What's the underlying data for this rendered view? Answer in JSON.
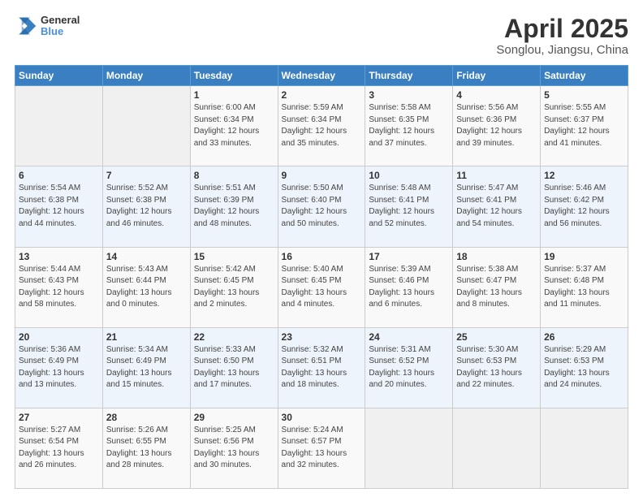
{
  "header": {
    "logo_line1": "General",
    "logo_line2": "Blue",
    "main_title": "April 2025",
    "subtitle": "Songlou, Jiangsu, China"
  },
  "calendar": {
    "days_of_week": [
      "Sunday",
      "Monday",
      "Tuesday",
      "Wednesday",
      "Thursday",
      "Friday",
      "Saturday"
    ],
    "weeks": [
      [
        {
          "day": "",
          "info": ""
        },
        {
          "day": "",
          "info": ""
        },
        {
          "day": "1",
          "info": "Sunrise: 6:00 AM\nSunset: 6:34 PM\nDaylight: 12 hours\nand 33 minutes."
        },
        {
          "day": "2",
          "info": "Sunrise: 5:59 AM\nSunset: 6:34 PM\nDaylight: 12 hours\nand 35 minutes."
        },
        {
          "day": "3",
          "info": "Sunrise: 5:58 AM\nSunset: 6:35 PM\nDaylight: 12 hours\nand 37 minutes."
        },
        {
          "day": "4",
          "info": "Sunrise: 5:56 AM\nSunset: 6:36 PM\nDaylight: 12 hours\nand 39 minutes."
        },
        {
          "day": "5",
          "info": "Sunrise: 5:55 AM\nSunset: 6:37 PM\nDaylight: 12 hours\nand 41 minutes."
        }
      ],
      [
        {
          "day": "6",
          "info": "Sunrise: 5:54 AM\nSunset: 6:38 PM\nDaylight: 12 hours\nand 44 minutes."
        },
        {
          "day": "7",
          "info": "Sunrise: 5:52 AM\nSunset: 6:38 PM\nDaylight: 12 hours\nand 46 minutes."
        },
        {
          "day": "8",
          "info": "Sunrise: 5:51 AM\nSunset: 6:39 PM\nDaylight: 12 hours\nand 48 minutes."
        },
        {
          "day": "9",
          "info": "Sunrise: 5:50 AM\nSunset: 6:40 PM\nDaylight: 12 hours\nand 50 minutes."
        },
        {
          "day": "10",
          "info": "Sunrise: 5:48 AM\nSunset: 6:41 PM\nDaylight: 12 hours\nand 52 minutes."
        },
        {
          "day": "11",
          "info": "Sunrise: 5:47 AM\nSunset: 6:41 PM\nDaylight: 12 hours\nand 54 minutes."
        },
        {
          "day": "12",
          "info": "Sunrise: 5:46 AM\nSunset: 6:42 PM\nDaylight: 12 hours\nand 56 minutes."
        }
      ],
      [
        {
          "day": "13",
          "info": "Sunrise: 5:44 AM\nSunset: 6:43 PM\nDaylight: 12 hours\nand 58 minutes."
        },
        {
          "day": "14",
          "info": "Sunrise: 5:43 AM\nSunset: 6:44 PM\nDaylight: 13 hours\nand 0 minutes."
        },
        {
          "day": "15",
          "info": "Sunrise: 5:42 AM\nSunset: 6:45 PM\nDaylight: 13 hours\nand 2 minutes."
        },
        {
          "day": "16",
          "info": "Sunrise: 5:40 AM\nSunset: 6:45 PM\nDaylight: 13 hours\nand 4 minutes."
        },
        {
          "day": "17",
          "info": "Sunrise: 5:39 AM\nSunset: 6:46 PM\nDaylight: 13 hours\nand 6 minutes."
        },
        {
          "day": "18",
          "info": "Sunrise: 5:38 AM\nSunset: 6:47 PM\nDaylight: 13 hours\nand 8 minutes."
        },
        {
          "day": "19",
          "info": "Sunrise: 5:37 AM\nSunset: 6:48 PM\nDaylight: 13 hours\nand 11 minutes."
        }
      ],
      [
        {
          "day": "20",
          "info": "Sunrise: 5:36 AM\nSunset: 6:49 PM\nDaylight: 13 hours\nand 13 minutes."
        },
        {
          "day": "21",
          "info": "Sunrise: 5:34 AM\nSunset: 6:49 PM\nDaylight: 13 hours\nand 15 minutes."
        },
        {
          "day": "22",
          "info": "Sunrise: 5:33 AM\nSunset: 6:50 PM\nDaylight: 13 hours\nand 17 minutes."
        },
        {
          "day": "23",
          "info": "Sunrise: 5:32 AM\nSunset: 6:51 PM\nDaylight: 13 hours\nand 18 minutes."
        },
        {
          "day": "24",
          "info": "Sunrise: 5:31 AM\nSunset: 6:52 PM\nDaylight: 13 hours\nand 20 minutes."
        },
        {
          "day": "25",
          "info": "Sunrise: 5:30 AM\nSunset: 6:53 PM\nDaylight: 13 hours\nand 22 minutes."
        },
        {
          "day": "26",
          "info": "Sunrise: 5:29 AM\nSunset: 6:53 PM\nDaylight: 13 hours\nand 24 minutes."
        }
      ],
      [
        {
          "day": "27",
          "info": "Sunrise: 5:27 AM\nSunset: 6:54 PM\nDaylight: 13 hours\nand 26 minutes."
        },
        {
          "day": "28",
          "info": "Sunrise: 5:26 AM\nSunset: 6:55 PM\nDaylight: 13 hours\nand 28 minutes."
        },
        {
          "day": "29",
          "info": "Sunrise: 5:25 AM\nSunset: 6:56 PM\nDaylight: 13 hours\nand 30 minutes."
        },
        {
          "day": "30",
          "info": "Sunrise: 5:24 AM\nSunset: 6:57 PM\nDaylight: 13 hours\nand 32 minutes."
        },
        {
          "day": "",
          "info": ""
        },
        {
          "day": "",
          "info": ""
        },
        {
          "day": "",
          "info": ""
        }
      ]
    ]
  }
}
